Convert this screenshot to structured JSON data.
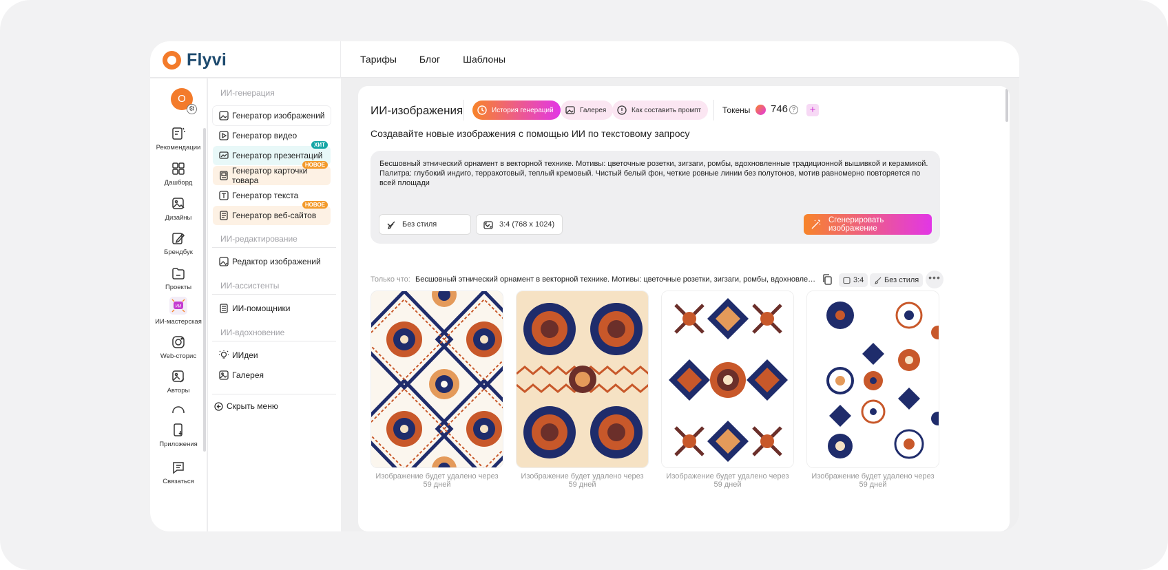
{
  "brand": {
    "name": "Flyvi"
  },
  "topnav": [
    "Тарифы",
    "Блог",
    "Шаблоны"
  ],
  "user": {
    "initial": "O"
  },
  "rail": [
    {
      "label": "Рекомендации",
      "icon": "recommendations-icon"
    },
    {
      "label": "Дашборд",
      "icon": "dashboard-icon"
    },
    {
      "label": "Дизайны",
      "icon": "designs-icon"
    },
    {
      "label": "Брендбук",
      "icon": "brandbook-icon"
    },
    {
      "label": "Проекты",
      "icon": "folder-icon"
    },
    {
      "label": "ИИ-мастерская",
      "icon": "ai-workshop-icon",
      "badge": "ИИ"
    },
    {
      "label": "Web-сторис",
      "icon": "web-stories-icon"
    },
    {
      "label": "Авторы",
      "icon": "authors-icon"
    },
    {
      "label": "Приложения",
      "icon": "apps-icon"
    },
    {
      "label": "Связаться",
      "icon": "contact-icon"
    }
  ],
  "menu": {
    "group_generation": "ИИ-генерация",
    "group_editing": "ИИ-редактирование",
    "group_assistants": "ИИ-ассистенты",
    "group_inspiration": "ИИ-вдохновение",
    "items": {
      "image_gen": "Генератор изображений",
      "video_gen": "Генератор видео",
      "presentation_gen": "Генератор презентаций",
      "product_card_gen": "Генератор карточки товара",
      "text_gen": "Генератор текста",
      "website_gen": "Генератор веб-сайтов",
      "image_editor": "Редактор изображений",
      "assistants": "ИИ-помощники",
      "ideas": "ИИдеи",
      "gallery": "Галерея"
    },
    "badge_hit": "ХИТ",
    "badge_new": "НОВОЕ",
    "hide_menu": "Скрыть меню"
  },
  "main": {
    "title": "ИИ-изображения",
    "chips": {
      "history": "История генераций",
      "gallery": "Галерея",
      "how_to": "Как составить промпт"
    },
    "tokens_label": "Токены",
    "tokens_value": "746",
    "subtitle": "Создавайте новые изображения с помощью ИИ по текстовому запросу",
    "prompt": "Бесшовный этнический орнамент в векторной технике. Мотивы: цветочные розетки, зигзаги, ромбы, вдохновленные традиционной вышивкой и керамикой. Палитра: глубокий индиго, терракотовый, теплый кремовый. Чистый белый фон, четкие ровные линии без полутонов, мотив равномерно повторяется по всей площади",
    "style_select": "Без стиля",
    "ratio_select": "3:4 (768 x 1024)",
    "generate_button": "Сгенерировать изображение",
    "recent_label": "Только что:",
    "recent_prompt": "Бесшовный этнический орнамент в векторной технике. Мотивы: цветочные розетки, зигзаги, ромбы, вдохновленные традиционной вышивкой и керамикой.",
    "recent_ratio": "3:4",
    "recent_style": "Без стиля",
    "image_caption": "Изображение будет удалено через 59 дней"
  },
  "colors": {
    "accent_orange": "#f7842a",
    "accent_magenta": "#e236e6",
    "indigo": "#1f2c6b",
    "terracotta": "#c8582a",
    "cream": "#f6e2c4"
  }
}
